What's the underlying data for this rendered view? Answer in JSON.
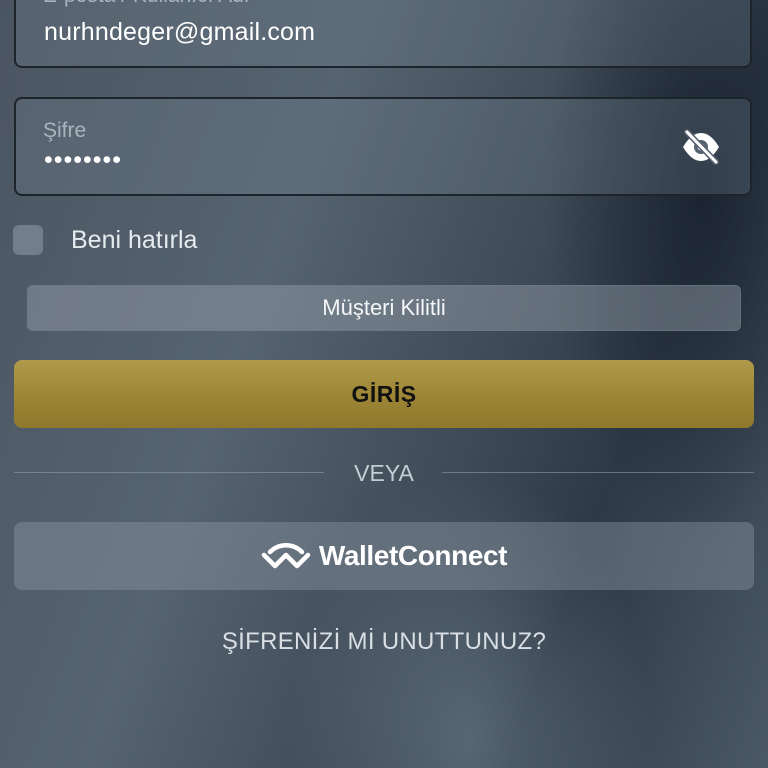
{
  "login_form": {
    "email": {
      "label": "E-posta / Kullanıcı Adı",
      "value": "nurhndeger@gmail.com"
    },
    "password": {
      "label": "Şifre",
      "value": "••••••••",
      "visibility_icon": "eye-off-icon"
    },
    "remember_me": {
      "label": "Beni hatırla",
      "checked": false
    },
    "status_message": "Müşteri Kilitli",
    "login_button": "GİRİŞ",
    "divider_text": "VEYA",
    "walletconnect_button": {
      "label": "WalletConnect",
      "icon": "walletconnect-logo"
    },
    "forgot_password": "ŞİFRENİZİ Mİ UNUTTUNUZ?"
  },
  "colors": {
    "login_button": "#9c8535",
    "field_border": "#1d242c",
    "text_primary": "#ffffff"
  }
}
